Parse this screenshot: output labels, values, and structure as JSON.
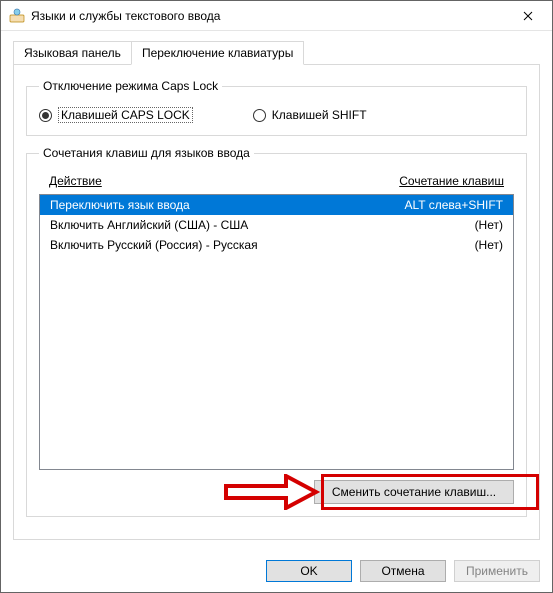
{
  "window": {
    "title": "Языки и службы текстового ввода"
  },
  "tabs": {
    "tab1": "Языковая панель",
    "tab2": "Переключение клавиатуры"
  },
  "capslock": {
    "legend": "Отключение режима Caps Lock",
    "opt1": "Клавишей CAPS LOCK",
    "opt2": "Клавишей SHIFT"
  },
  "hotkeys": {
    "legend": "Сочетания клавиш для языков ввода",
    "header_action": "Действие",
    "header_combo": "Сочетание клавиш",
    "rows": [
      {
        "action": "Переключить язык ввода",
        "combo": "ALT слева+SHIFT"
      },
      {
        "action": "Включить Английский (США) - США",
        "combo": "(Нет)"
      },
      {
        "action": "Включить Русский (Россия) - Русская",
        "combo": "(Нет)"
      }
    ],
    "change_button": "Сменить сочетание клавиш..."
  },
  "buttons": {
    "ok": "OK",
    "cancel": "Отмена",
    "apply": "Применить"
  },
  "annotations": {
    "highlight_color": "#d40000"
  }
}
